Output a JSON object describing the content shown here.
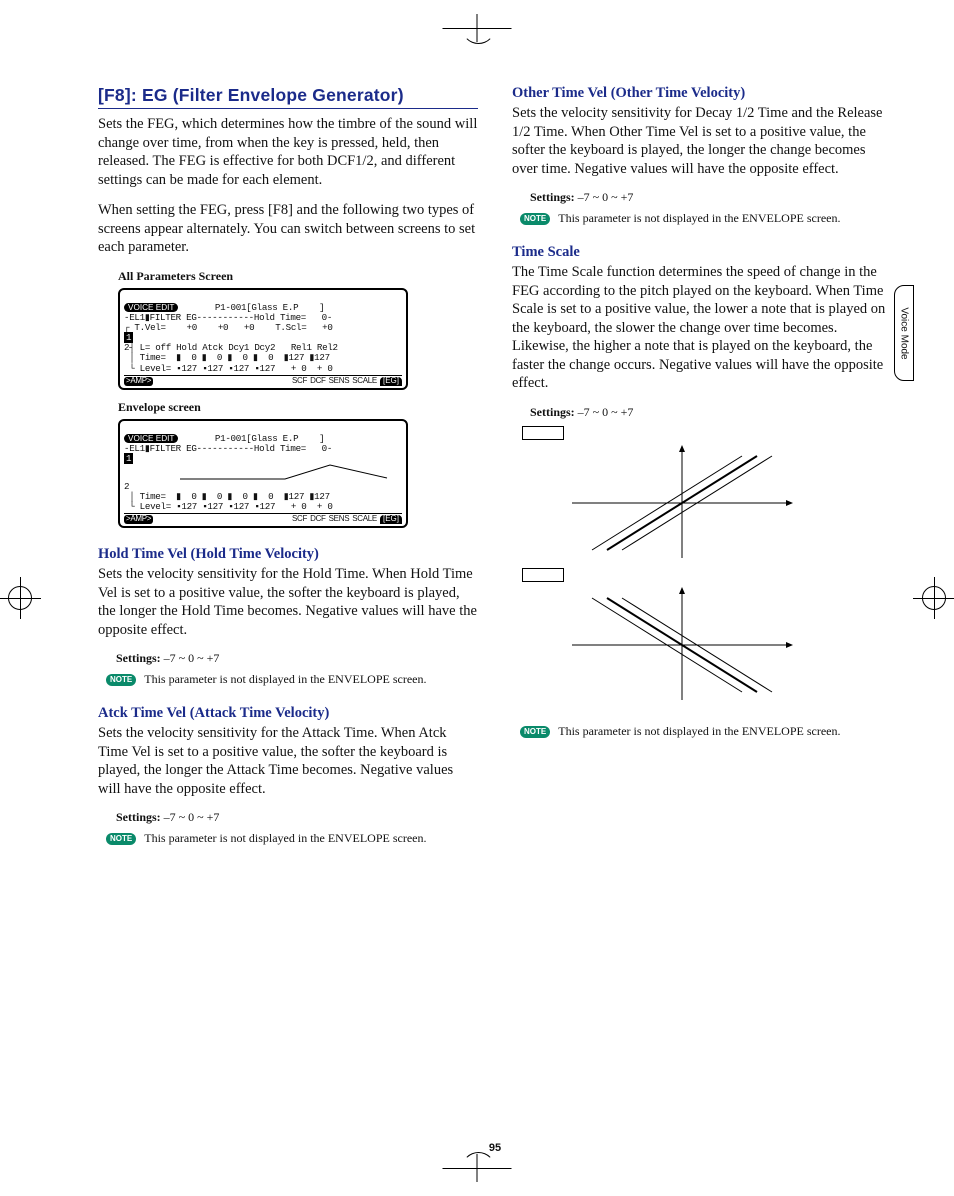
{
  "sidebar_tab": "Voice Mode",
  "page_number": "95",
  "section_title": "[F8]: EG (Filter Envelope Generator)",
  "intro_p1": "Sets the FEG, which determines how the timbre of the sound will change over time, from when the key is pressed, held, then released. The FEG is effective for both DCF1/2, and different settings can be made for each element.",
  "intro_p2": "When setting the FEG, press [F8] and the following two types of screens appear alternately. You can switch between screens to set each parameter.",
  "caption1": "All Parameters Screen",
  "caption2": "Envelope screen",
  "lcd_header_chip": "VOICE EDIT",
  "lcd_header_patch": "P1-001[Glass E.P    ]",
  "lcd1_line1": "-EL1▮FILTER EG-----------Hold Time=   0-",
  "lcd1_line2": "┌ T.Vel=    +0    +0   +0    T.Scl=   +0",
  "lcd1_line3": "┤ L= off Hold Atck Dcy1 Dcy2   Rel1 Rel2",
  "lcd1_line4": "│ Time=  ▮  0 ▮  0 ▮  0 ▮  0  ▮127 ▮127",
  "lcd1_line5": "└ Level= ▪127 ▪127 ▪127 ▪127   + 0  + 0",
  "lcd2_line1": "-EL1▮FILTER EG-----------Hold Time=   0-",
  "lcd2_line3": "│ Time=  ▮  0 ▮  0 ▮  0 ▮  0  ▮127 ▮127",
  "lcd2_line4": "└ Level= ▪127 ▪127 ▪127 ▪127   + 0  + 0",
  "lcd_tab_amp": ">AMP>",
  "lcd_tabs": [
    "SCF",
    "DCF",
    "SENS",
    "SCALE"
  ],
  "lcd_tab_sel": "[EG]",
  "note_label": "NOTE",
  "params": {
    "hold": {
      "title": "Hold Time Vel (Hold Time Velocity)",
      "body": "Sets the velocity sensitivity for the Hold Time. When Hold Time Vel is set to a positive value, the softer the keyboard is played, the longer the Hold Time becomes. Negative values will have the opposite effect.",
      "settings": "–7 ~ 0 ~ +7",
      "note": "This parameter is not displayed in the ENVELOPE screen."
    },
    "atck": {
      "title": "Atck Time Vel (Attack Time Velocity)",
      "body": "Sets the velocity sensitivity for the Attack Time. When Atck Time Vel is set to a positive value, the softer the keyboard is played, the longer the Attack Time becomes. Negative values will have the opposite effect.",
      "settings": "–7 ~ 0 ~ +7",
      "note": "This parameter is not displayed in the ENVELOPE screen."
    },
    "other": {
      "title": "Other Time Vel (Other Time Velocity)",
      "body": "Sets the velocity sensitivity for Decay 1/2 Time and the Release 1/2 Time. When Other Time Vel is set to a positive value, the softer the keyboard is played, the longer the change becomes over time. Negative values will have the opposite effect.",
      "settings": "–7 ~ 0 ~ +7",
      "note": "This parameter is not displayed in the ENVELOPE screen."
    },
    "tscale": {
      "title": "Time Scale",
      "body": "The Time Scale function determines the speed of change in the FEG according to the pitch played on the keyboard. When Time Scale is set to a positive value, the lower a note that is played on the keyboard, the slower the change over time becomes. Likewise, the higher a note that is played on the keyboard, the faster the change occurs. Negative values will have the opposite effect.",
      "settings": "–7 ~ 0 ~ +7",
      "note": "This parameter is not displayed in the ENVELOPE screen."
    }
  },
  "settings_label": "Settings:"
}
